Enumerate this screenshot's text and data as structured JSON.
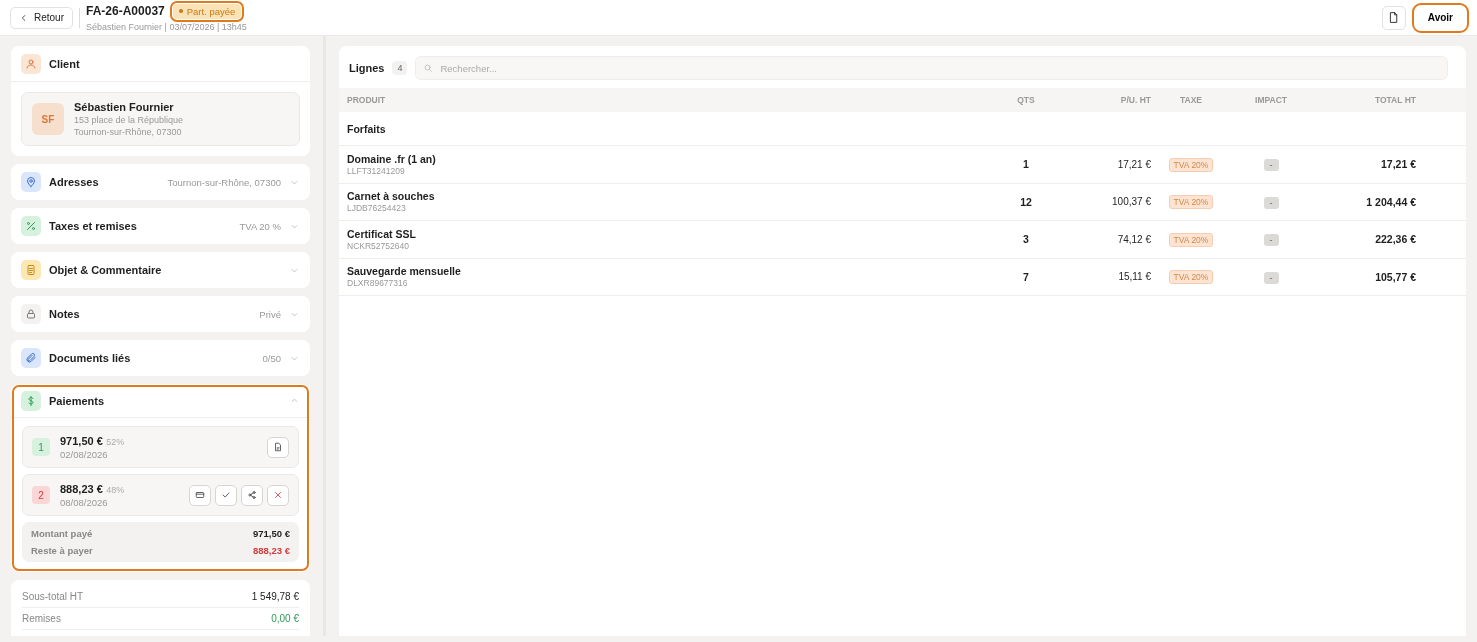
{
  "header": {
    "back": "Retour",
    "title": "FA-26-A00037",
    "status": {
      "label": "Part. payée",
      "kind": "partial"
    },
    "subtitle": "Sébastien Fournier | 03/07/2026 | 13h45",
    "action": "Avoir"
  },
  "client": {
    "title": "Client",
    "avatar": "SF",
    "name": "Sébastien Fournier",
    "address": "153 place de la République",
    "city": "Tournon-sur-Rhône, 07300"
  },
  "sections": [
    {
      "kind": "pin",
      "title": "Adresses",
      "value": "Tournon-sur-Rhône, 07300",
      "expanded": false
    },
    {
      "kind": "percent",
      "title": "Taxes et remises",
      "value": "TVA 20 %",
      "expanded": false
    },
    {
      "kind": "note",
      "title": "Objet & Commentaire",
      "expanded": false
    },
    {
      "kind": "lock",
      "title": "Notes",
      "value": "Privé",
      "expanded": false
    },
    {
      "kind": "clip",
      "title": "Documents liés",
      "value": "0/50",
      "expanded": false
    }
  ],
  "payments": {
    "title": "Paiements",
    "expanded": true,
    "items": [
      {
        "number": "1",
        "amount": "971,50 €",
        "share": "52%",
        "date": "02/08/2026",
        "kind": "paid",
        "actions": [
          {
            "kind": "document"
          }
        ]
      },
      {
        "number": "2",
        "amount": "888,23 €",
        "share": "48%",
        "date": "08/08/2026",
        "kind": "due",
        "actions": [
          {
            "kind": "card"
          },
          {
            "kind": "check"
          },
          {
            "kind": "share"
          },
          {
            "kind": "delete"
          }
        ]
      }
    ],
    "summary": [
      {
        "label": "Montant payé",
        "value": "971,50 €",
        "kind": "paid"
      },
      {
        "label": "Reste à payer",
        "value": "888,23 €",
        "kind": "due"
      }
    ]
  },
  "totals": [
    {
      "label": "Sous-total HT",
      "value": "1 549,78 €",
      "kind": "normal"
    },
    {
      "label": "Remises",
      "value": "0,00 €",
      "kind": "discount"
    }
  ],
  "lines": {
    "title": "Lignes",
    "count": "4",
    "search": {
      "placeholder": "Rechercher..."
    },
    "columns": [
      "PRODUIT",
      "QTS",
      "P/U. HT",
      "TAXE",
      "IMPACT",
      "TOTAL HT"
    ],
    "group": "Forfaits",
    "rows": [
      {
        "name": "Domaine .fr (1 an)",
        "ref": "LLFT31241209",
        "qty": "1",
        "unit": "17,21 €",
        "tax": "TVA 20%",
        "impact": "-",
        "total": "17,21 €"
      },
      {
        "name": "Carnet à souches",
        "ref": "LJDB76254423",
        "qty": "12",
        "unit": "100,37 €",
        "tax": "TVA 20%",
        "impact": "-",
        "total": "1 204,44 €"
      },
      {
        "name": "Certificat SSL",
        "ref": "NCKR52752640",
        "qty": "3",
        "unit": "74,12 €",
        "tax": "TVA 20%",
        "impact": "-",
        "total": "222,36 €"
      },
      {
        "name": "Sauvegarde mensuelle",
        "ref": "DLXR89677316",
        "qty": "7",
        "unit": "15,11 €",
        "tax": "TVA 20%",
        "impact": "-",
        "total": "105,77 €"
      }
    ]
  }
}
